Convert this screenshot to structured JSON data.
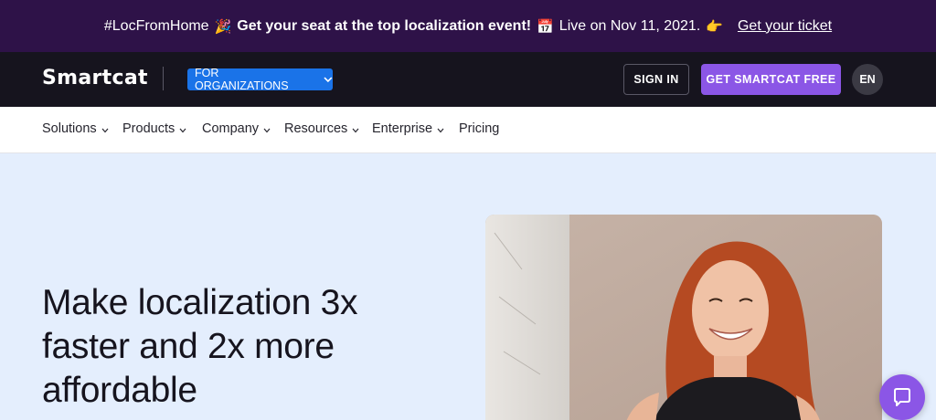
{
  "promo": {
    "hashtag": "#LocFromHome",
    "emoji_party": "🎉",
    "headline": "Get your seat at the top localization event!",
    "emoji_calendar": "📅",
    "live_text": "Live on Nov 11, 2021.",
    "emoji_point": "👉",
    "cta_link": "Get your ticket"
  },
  "header": {
    "logo": "Smartcat",
    "org_select": "FOR ORGANIZATIONS",
    "sign_in": "SIGN IN",
    "get_free": "GET SMARTCAT FREE",
    "language": "EN"
  },
  "nav": {
    "items": [
      {
        "label": "Solutions"
      },
      {
        "label": "Products"
      },
      {
        "label": "Company"
      },
      {
        "label": "Resources"
      },
      {
        "label": "Enterprise"
      },
      {
        "label": "Pricing"
      }
    ]
  },
  "hero": {
    "title_line1": "Make localization 3x",
    "title_line2": "faster and 2x more",
    "title_line3": "affordable"
  },
  "colors": {
    "banner_bg": "#2e1248",
    "header_bg": "#16141e",
    "accent_purple": "#8b56e6",
    "select_blue": "#1a73e8",
    "hero_bg": "#e4eefd"
  },
  "icons": {
    "chevron": "chevron-down-icon",
    "chat": "chat-bubble-icon"
  }
}
